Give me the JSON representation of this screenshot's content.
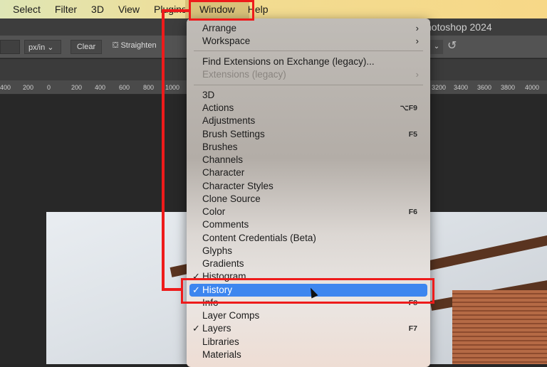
{
  "menubar": {
    "items": [
      "Select",
      "Filter",
      "3D",
      "View",
      "Plugins",
      "Window",
      "Help"
    ],
    "active": "Window"
  },
  "titlebar": {
    "title": "hotoshop 2024"
  },
  "options": {
    "units": "px/in ⌄",
    "clear": "Clear",
    "straighten": "Straighten",
    "reset_icon": "reset-icon"
  },
  "ruler": {
    "ticks": [
      "400",
      "200",
      "0",
      "200",
      "400",
      "600",
      "800",
      "1000",
      "3200",
      "3400",
      "3600",
      "3800",
      "4000"
    ]
  },
  "menu": {
    "items": [
      {
        "label": "Arrange",
        "submenu": true
      },
      {
        "label": "Workspace",
        "submenu": true
      },
      {
        "label": "Find Extensions on Exchange (legacy)..."
      },
      {
        "label": "Extensions (legacy)",
        "submenu": true,
        "disabled": true
      },
      {
        "label": "3D"
      },
      {
        "label": "Actions",
        "shortcut": "⌥F9"
      },
      {
        "label": "Adjustments"
      },
      {
        "label": "Brush Settings",
        "shortcut": "F5"
      },
      {
        "label": "Brushes"
      },
      {
        "label": "Channels"
      },
      {
        "label": "Character"
      },
      {
        "label": "Character Styles"
      },
      {
        "label": "Clone Source"
      },
      {
        "label": "Color",
        "shortcut": "F6"
      },
      {
        "label": "Comments"
      },
      {
        "label": "Content Credentials (Beta)"
      },
      {
        "label": "Glyphs"
      },
      {
        "label": "Gradients"
      },
      {
        "label": "Histogram",
        "checked": true
      },
      {
        "label": "History",
        "checked": true,
        "highlighted": true
      },
      {
        "label": "Info",
        "shortcut": "F8"
      },
      {
        "label": "Layer Comps"
      },
      {
        "label": "Layers",
        "checked": true,
        "shortcut": "F7"
      },
      {
        "label": "Libraries"
      },
      {
        "label": "Materials"
      }
    ],
    "checkmark": "✓",
    "submenu_arrow": "›"
  },
  "colors": {
    "highlight": "#3d86ef",
    "annotation": "#ee1b1b"
  }
}
